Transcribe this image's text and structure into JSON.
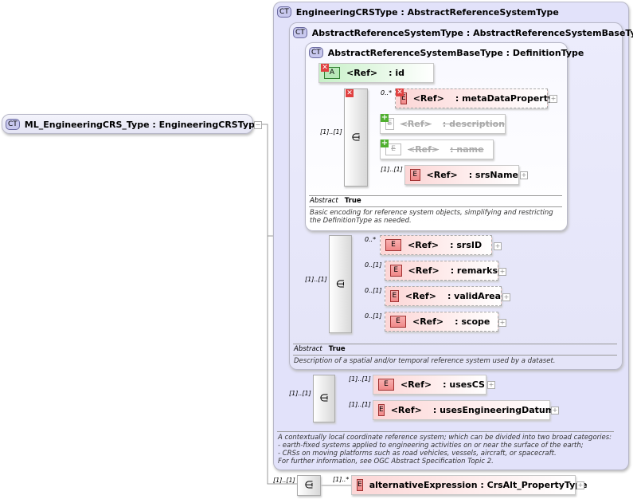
{
  "root": {
    "badge": "CT",
    "name": "ML_EngineeringCRS_Type : EngineeringCRSType"
  },
  "ct1": {
    "badge": "CT",
    "name": "EngineeringCRSType : AbstractReferenceSystemType",
    "description": [
      "A contextually local coordinate reference system; which can be divided into two broad categories:",
      "- earth-fixed systems applied to engineering activities on or near the surface of the earth;",
      "- CRSs on moving platforms such as road vehicles, vessels, aircraft, or spacecraft.",
      "For further information, see OGC Abstract Specification Topic 2."
    ]
  },
  "ct2": {
    "badge": "CT",
    "name": "AbstractReferenceSystemType : AbstractReferenceSystemBaseType",
    "abstract_label": "Abstract",
    "abstract_value": "True",
    "description": "Description of a spatial and/or temporal reference system used by a dataset."
  },
  "ct3": {
    "badge": "CT",
    "name": "AbstractReferenceSystemBaseType : DefinitionType",
    "abstract_label": "Abstract",
    "abstract_value": "True",
    "description": "Basic encoding for reference system objects, simplifying and restricting the DefinitionType as needed."
  },
  "attr_id": {
    "badge": "A",
    "ref": "<Ref>",
    "name": ": id"
  },
  "elements": [
    {
      "card": "0..*",
      "badge": "E",
      "ref": "<Ref>",
      "name": ": metaDataProperty"
    },
    {
      "card": "",
      "badge": "E",
      "ref": "<Ref>",
      "name": ": description"
    },
    {
      "card": "",
      "badge": "E",
      "ref": "<Ref>",
      "name": ": name"
    },
    {
      "card": "[1]..[1]",
      "badge": "E",
      "ref": "<Ref>",
      "name": ": srsName"
    },
    {
      "card": "0..*",
      "badge": "E",
      "ref": "<Ref>",
      "name": ": srsID"
    },
    {
      "card": "0..[1]",
      "badge": "E",
      "ref": "<Ref>",
      "name": ": remarks"
    },
    {
      "card": "0..[1]",
      "badge": "E",
      "ref": "<Ref>",
      "name": ": validArea"
    },
    {
      "card": "0..[1]",
      "badge": "E",
      "ref": "<Ref>",
      "name": ": scope"
    },
    {
      "card": "[1]..[1]",
      "badge": "E",
      "ref": "<Ref>",
      "name": ": usesCS"
    },
    {
      "card": "[1]..[1]",
      "badge": "E",
      "ref": "<Ref>",
      "name": ": usesEngineeringDatum"
    },
    {
      "card": "[1]..*",
      "badge": "E",
      "ref": "",
      "name": "alternativeExpression : CrsAlt_PropertyType"
    }
  ],
  "seq_cards": [
    "[1]..[1]",
    "[1]..[1]",
    "[1]..[1]",
    "[1]..[1]"
  ]
}
